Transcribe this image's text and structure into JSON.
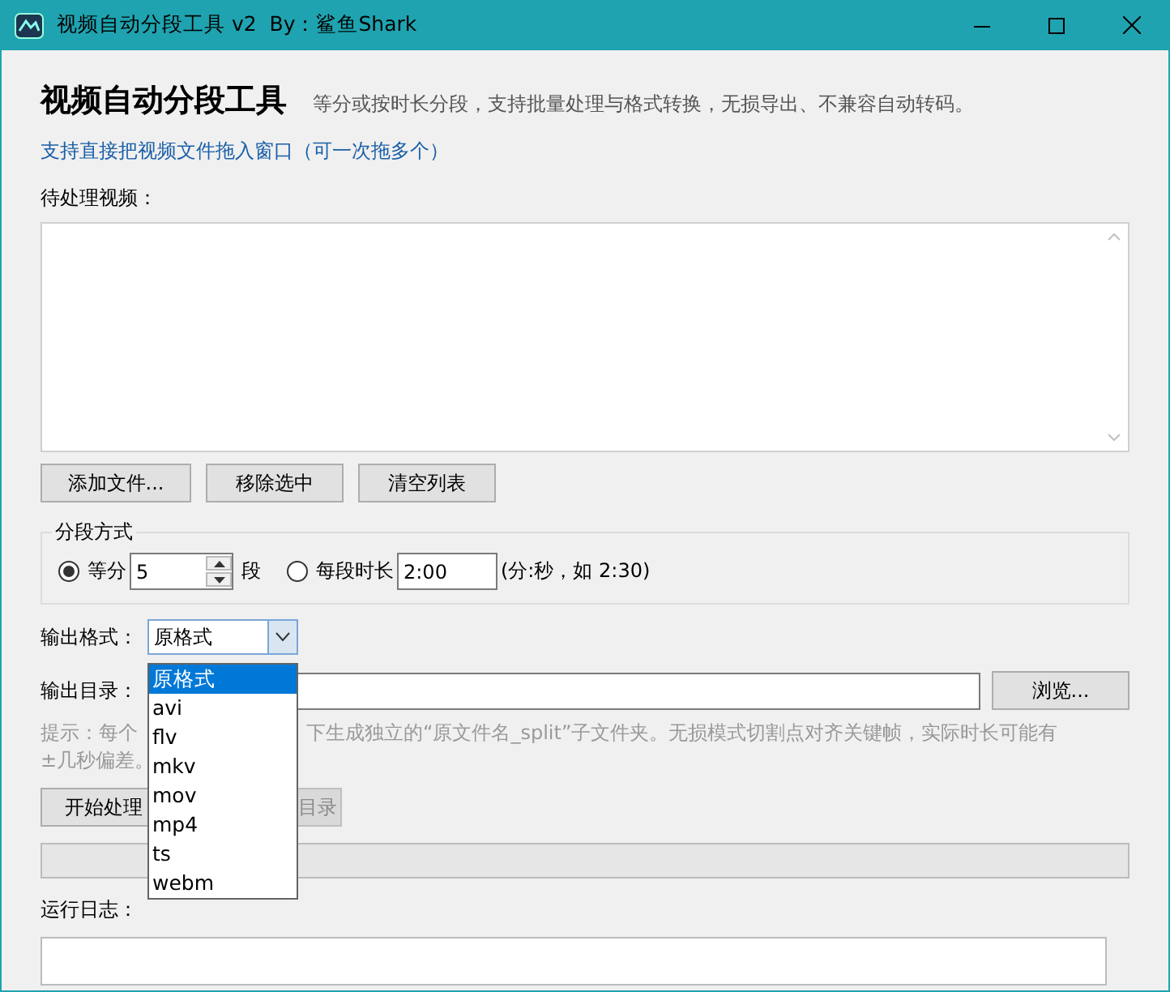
{
  "window": {
    "title": "视频自动分段工具 v2  By：鲨鱼Shark"
  },
  "header": {
    "title": "视频自动分段工具",
    "subtitle": "等分或按时长分段，支持批量处理与格式转换，无损导出、不兼容自动转码。"
  },
  "drop_hint": "支持直接把视频文件拖入窗口（可一次拖多个）",
  "file_list": {
    "label": "待处理视频："
  },
  "list_buttons": [
    "添加文件...",
    "移除选中",
    "清空列表"
  ],
  "split_mode": {
    "title": "分段方式",
    "options": [
      {
        "kind": "count",
        "label": "等分",
        "selected": true,
        "value": "5",
        "unit": "段"
      },
      {
        "kind": "duration",
        "label": "每段时长",
        "selected": false,
        "value": "2:00",
        "note": "(分:秒，如 2:30)"
      }
    ]
  },
  "output_format": {
    "label": "输出格式：",
    "value": "原格式",
    "expanded": true,
    "options": [
      {
        "label": "原格式",
        "selected": true
      },
      {
        "label": "avi",
        "selected": false
      },
      {
        "label": "flv",
        "selected": false
      },
      {
        "label": "mkv",
        "selected": false
      },
      {
        "label": "mov",
        "selected": false
      },
      {
        "label": "mp4",
        "selected": false
      },
      {
        "label": "ts",
        "selected": false
      },
      {
        "label": "webm",
        "selected": false
      }
    ]
  },
  "output_dir": {
    "label": "输出目录：",
    "browse": "浏览..."
  },
  "hint": {
    "line_1_start": "提示：每个",
    "line_1_end": "下生成独立的“原文件名_split”子文件夹。无损模式切割点对齐关键帧，实际时长可能有",
    "line_2": "±几秒偏差。"
  },
  "actions": [
    {
      "label": "开始处理",
      "disabled": false
    },
    {
      "label": "目录",
      "disabled": true
    }
  ],
  "progress": {
    "level": 0
  },
  "log": {
    "label": "运行日志："
  }
}
